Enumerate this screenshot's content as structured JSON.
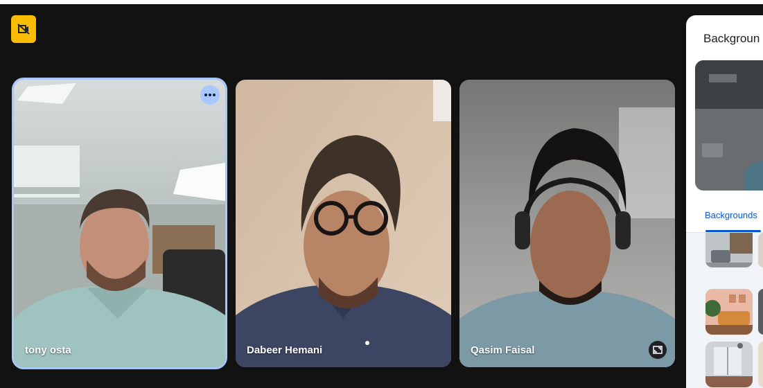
{
  "participants": [
    {
      "name": "tony osta",
      "active": true
    },
    {
      "name": "Dabeer Hemani",
      "active": false
    },
    {
      "name": "Qasim Faisal",
      "active": false
    }
  ],
  "icons": {
    "recording": "camera-off-icon",
    "more": "more-options-icon",
    "expand": "expand-icon"
  },
  "panel": {
    "title": "Backgroun",
    "tab_label": "Backgrounds"
  },
  "colors": {
    "accent": "#a8c7fa",
    "badge": "#fbbc04",
    "link": "#0b57d0"
  }
}
